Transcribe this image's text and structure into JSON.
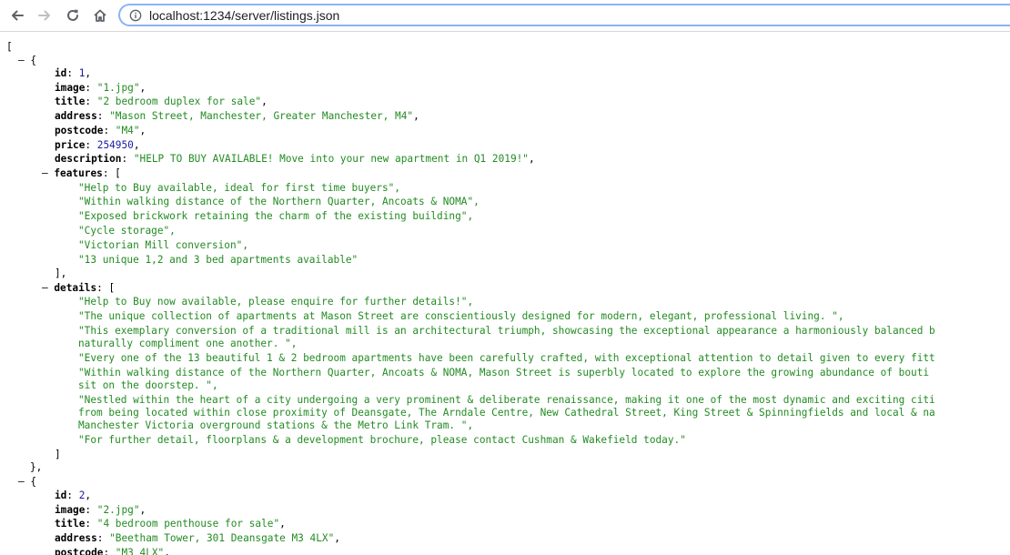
{
  "browser": {
    "url": "localhost:1234/server/listings.json",
    "back_icon": "arrow-left-icon",
    "forward_icon": "arrow-right-icon",
    "reload_icon": "reload-icon",
    "home_icon": "home-icon",
    "info_icon": "info-icon"
  },
  "json_view": {
    "colors": {
      "string": "#228b22",
      "number": "#1a1aa6",
      "key": "#000000"
    },
    "toggle": "–",
    "open_bracket": "[",
    "listings": [
      {
        "id": "1",
        "image": "\"1.jpg\"",
        "title": "\"2 bedroom duplex for sale\"",
        "address": "\"Mason Street, Manchester, Greater Manchester, M4\"",
        "postcode": "\"M4\"",
        "price": "254950",
        "description": "\"HELP TO BUY AVAILABLE! Move into your new apartment in Q1 2019!\"",
        "features": [
          "\"Help to Buy available, ideal for first time buyers\",",
          "\"Within walking distance of the Northern Quarter, Ancoats & NOMA\",",
          "\"Exposed brickwork retaining the charm of the existing building\",",
          "\"Cycle storage\",",
          "\"Victorian Mill conversion\",",
          "\"13 unique 1,2 and 3 bed apartments available\""
        ],
        "details": [
          "\"Help to Buy now available, please enquire for further details!\",",
          "\"The unique collection of apartments at Mason Street are conscientiously designed for modern, elegant, professional living. \",",
          "\"This exemplary conversion of a traditional mill is an architectural triumph, showcasing the exceptional appearance a harmoniously balanced b",
          "naturally compliment one another. \",",
          "\"Every one of the 13 beautiful 1 & 2 bedroom apartments have been carefully crafted, with exceptional attention to detail given to every fitt",
          "\"Within walking distance of the Northern Quarter, Ancoats & NOMA, Mason Street is superbly located to explore the growing abundance of bouti",
          "sit on the doorstep. \",",
          "\"Nestled within the heart of a city undergoing a very prominent & deliberate renaissance, making it one of the most dynamic and exciting citi",
          "from being located within close proximity of Deansgate, The Arndale Centre, New Cathedral Street, King Street & Spinningfields and local & na",
          "Manchester Victoria overground stations & the Metro Link Tram. \",",
          "\"For further detail, floorplans & a development brochure, please contact Cushman & Wakefield today.\""
        ]
      },
      {
        "id": "2",
        "image": "\"2.jpg\"",
        "title": "\"4 bedroom penthouse for sale\"",
        "address": "\"Beetham Tower, 301 Deansgate M3 4LX\"",
        "postcode": "\"M3 4LX\""
      }
    ]
  }
}
